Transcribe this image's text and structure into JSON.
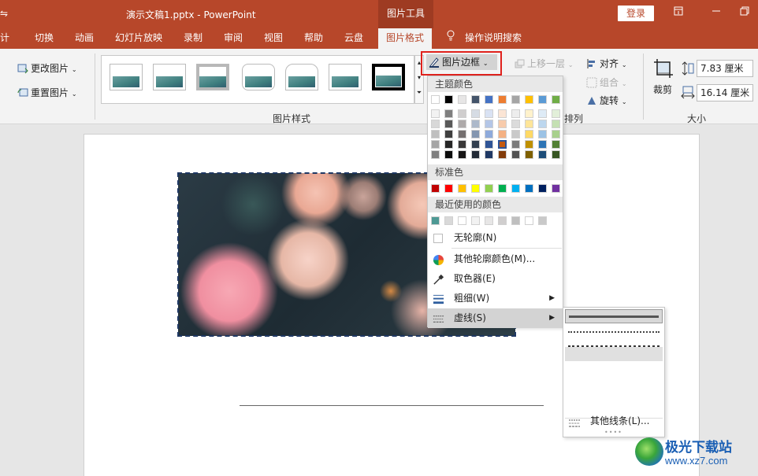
{
  "titlebar": {
    "doc_title": "演示文稿1.pptx  -  PowerPoint",
    "context_tab": "图片工具",
    "login": "登录",
    "restore_icon": "ribbon-display-icon",
    "minimize_icon": "minimize-icon",
    "maximize_icon": "restore-icon"
  },
  "tabs": {
    "items": [
      "设计",
      "切换",
      "动画",
      "幻灯片放映",
      "录制",
      "审阅",
      "视图",
      "帮助",
      "云盘",
      "图片格式"
    ],
    "partial_first": "计",
    "active": "图片格式",
    "tell_me": "操作说明搜索"
  },
  "ribbon": {
    "change_picture": "更改图片",
    "reset_picture": "重置图片",
    "picture_styles_label": "图片样式",
    "picture_border": "图片边框",
    "bring_forward": "上移一层",
    "align": "对齐",
    "group": "组合",
    "rotate": "旋转",
    "arrange_label": "排列",
    "crop": "裁剪",
    "height": "7.83 厘米",
    "width": "16.14 厘米",
    "size_label": "大小"
  },
  "menu": {
    "theme_colors_label": "主题颜色",
    "standard_colors_label": "标准色",
    "recent_colors_label": "最近使用的颜色",
    "no_outline": "无轮廓(N)",
    "more_colors": "其他轮廓颜色(M)...",
    "eyedropper": "取色器(E)",
    "weight": "粗细(W)",
    "dashes": "虚线(S)",
    "theme_top_row": [
      "#ffffff",
      "#000000",
      "#e7e6e6",
      "#44546a",
      "#4472c4",
      "#ed7d31",
      "#a5a5a5",
      "#ffc000",
      "#5b9bd5",
      "#70ad47"
    ],
    "theme_shades": [
      [
        "#f2f2f2",
        "#7f7f7f",
        "#d0cece",
        "#d6dce4",
        "#d9e2f3",
        "#fbe5d5",
        "#ededed",
        "#fff2cc",
        "#deebf6",
        "#e2efd9"
      ],
      [
        "#d8d8d8",
        "#595959",
        "#aeaaaa",
        "#adb9ca",
        "#b4c6e7",
        "#f7cbac",
        "#dbdbdb",
        "#fee599",
        "#bdd7ee",
        "#c5e0b3"
      ],
      [
        "#bfbfbf",
        "#3f3f3f",
        "#757070",
        "#8496b0",
        "#8eaadb",
        "#f4b183",
        "#c9c9c9",
        "#ffd965",
        "#9cc3e5",
        "#a8d08d"
      ],
      [
        "#a5a5a5",
        "#262626",
        "#3a3838",
        "#323f4f",
        "#2f5496",
        "#c55a11",
        "#7b7b7b",
        "#bf9000",
        "#2e75b5",
        "#538135"
      ],
      [
        "#7f7f7f",
        "#0c0c0c",
        "#171616",
        "#222a35",
        "#1f3864",
        "#833c0b",
        "#525252",
        "#7f6000",
        "#1e4e79",
        "#375623"
      ]
    ],
    "standard": [
      "#c00000",
      "#ff0000",
      "#ffc000",
      "#ffff00",
      "#92d050",
      "#00b050",
      "#00b0f0",
      "#0070c0",
      "#002060",
      "#7030a0"
    ],
    "recent": [
      "#4e9994",
      "#d9d9d9",
      "#ffffff",
      "#f2f2f2",
      "#e7e6e6",
      "#d0cece",
      "#bfbfbf",
      "#ffffff",
      "#c9c9c9"
    ]
  },
  "submenu": {
    "more_lines": "其他线条(L)..."
  },
  "watermark": {
    "name": "极光下载站",
    "url": "www.xz7.com"
  }
}
